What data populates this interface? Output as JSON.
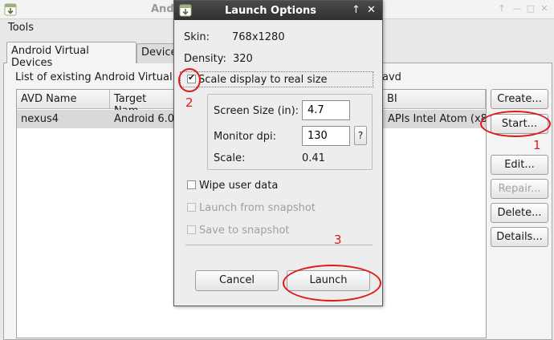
{
  "main_window": {
    "title": "Andr",
    "menu": {
      "tools": "Tools"
    },
    "tabs": [
      {
        "label": "Android Virtual Devices"
      },
      {
        "label": "Device"
      }
    ],
    "list_label": "List of existing Android Virtual",
    "list_label_tail": "avd",
    "table": {
      "headers": [
        "AVD Name",
        "Target Nam",
        "BI"
      ],
      "rows": [
        {
          "avd_name": "nexus4",
          "target": "Android 6.0",
          "abi": "APIs Intel Atom (x8"
        }
      ]
    },
    "buttons": {
      "create": "Create...",
      "start": "Start...",
      "edit": "Edit...",
      "repair": "Repair...",
      "delete": "Delete...",
      "details": "Details..."
    }
  },
  "dialog": {
    "title": "Launch Options",
    "skin_label": "Skin:",
    "skin_value": "768x1280",
    "density_label": "Density:",
    "density_value": "320",
    "scale_display": {
      "label": "Scale display to real size",
      "checked": true
    },
    "screen_size_label": "Screen Size (in):",
    "screen_size_value": "4.7",
    "monitor_dpi_label": "Monitor dpi:",
    "monitor_dpi_value": "130",
    "dpi_help": "?",
    "scale_label": "Scale:",
    "scale_value": "0.41",
    "wipe_user_data": {
      "label": "Wipe user data",
      "checked": false
    },
    "launch_from_snapshot": {
      "label": "Launch from snapshot",
      "checked": false,
      "enabled": false
    },
    "save_to_snapshot": {
      "label": "Save to snapshot",
      "checked": false,
      "enabled": false
    },
    "cancel_label": "Cancel",
    "launch_label": "Launch"
  },
  "annotations": {
    "step1": "1",
    "step2": "2",
    "step3": "3"
  },
  "colors": {
    "annotation": "#e01818",
    "dialog_titlebar": "#3a3a3a"
  }
}
